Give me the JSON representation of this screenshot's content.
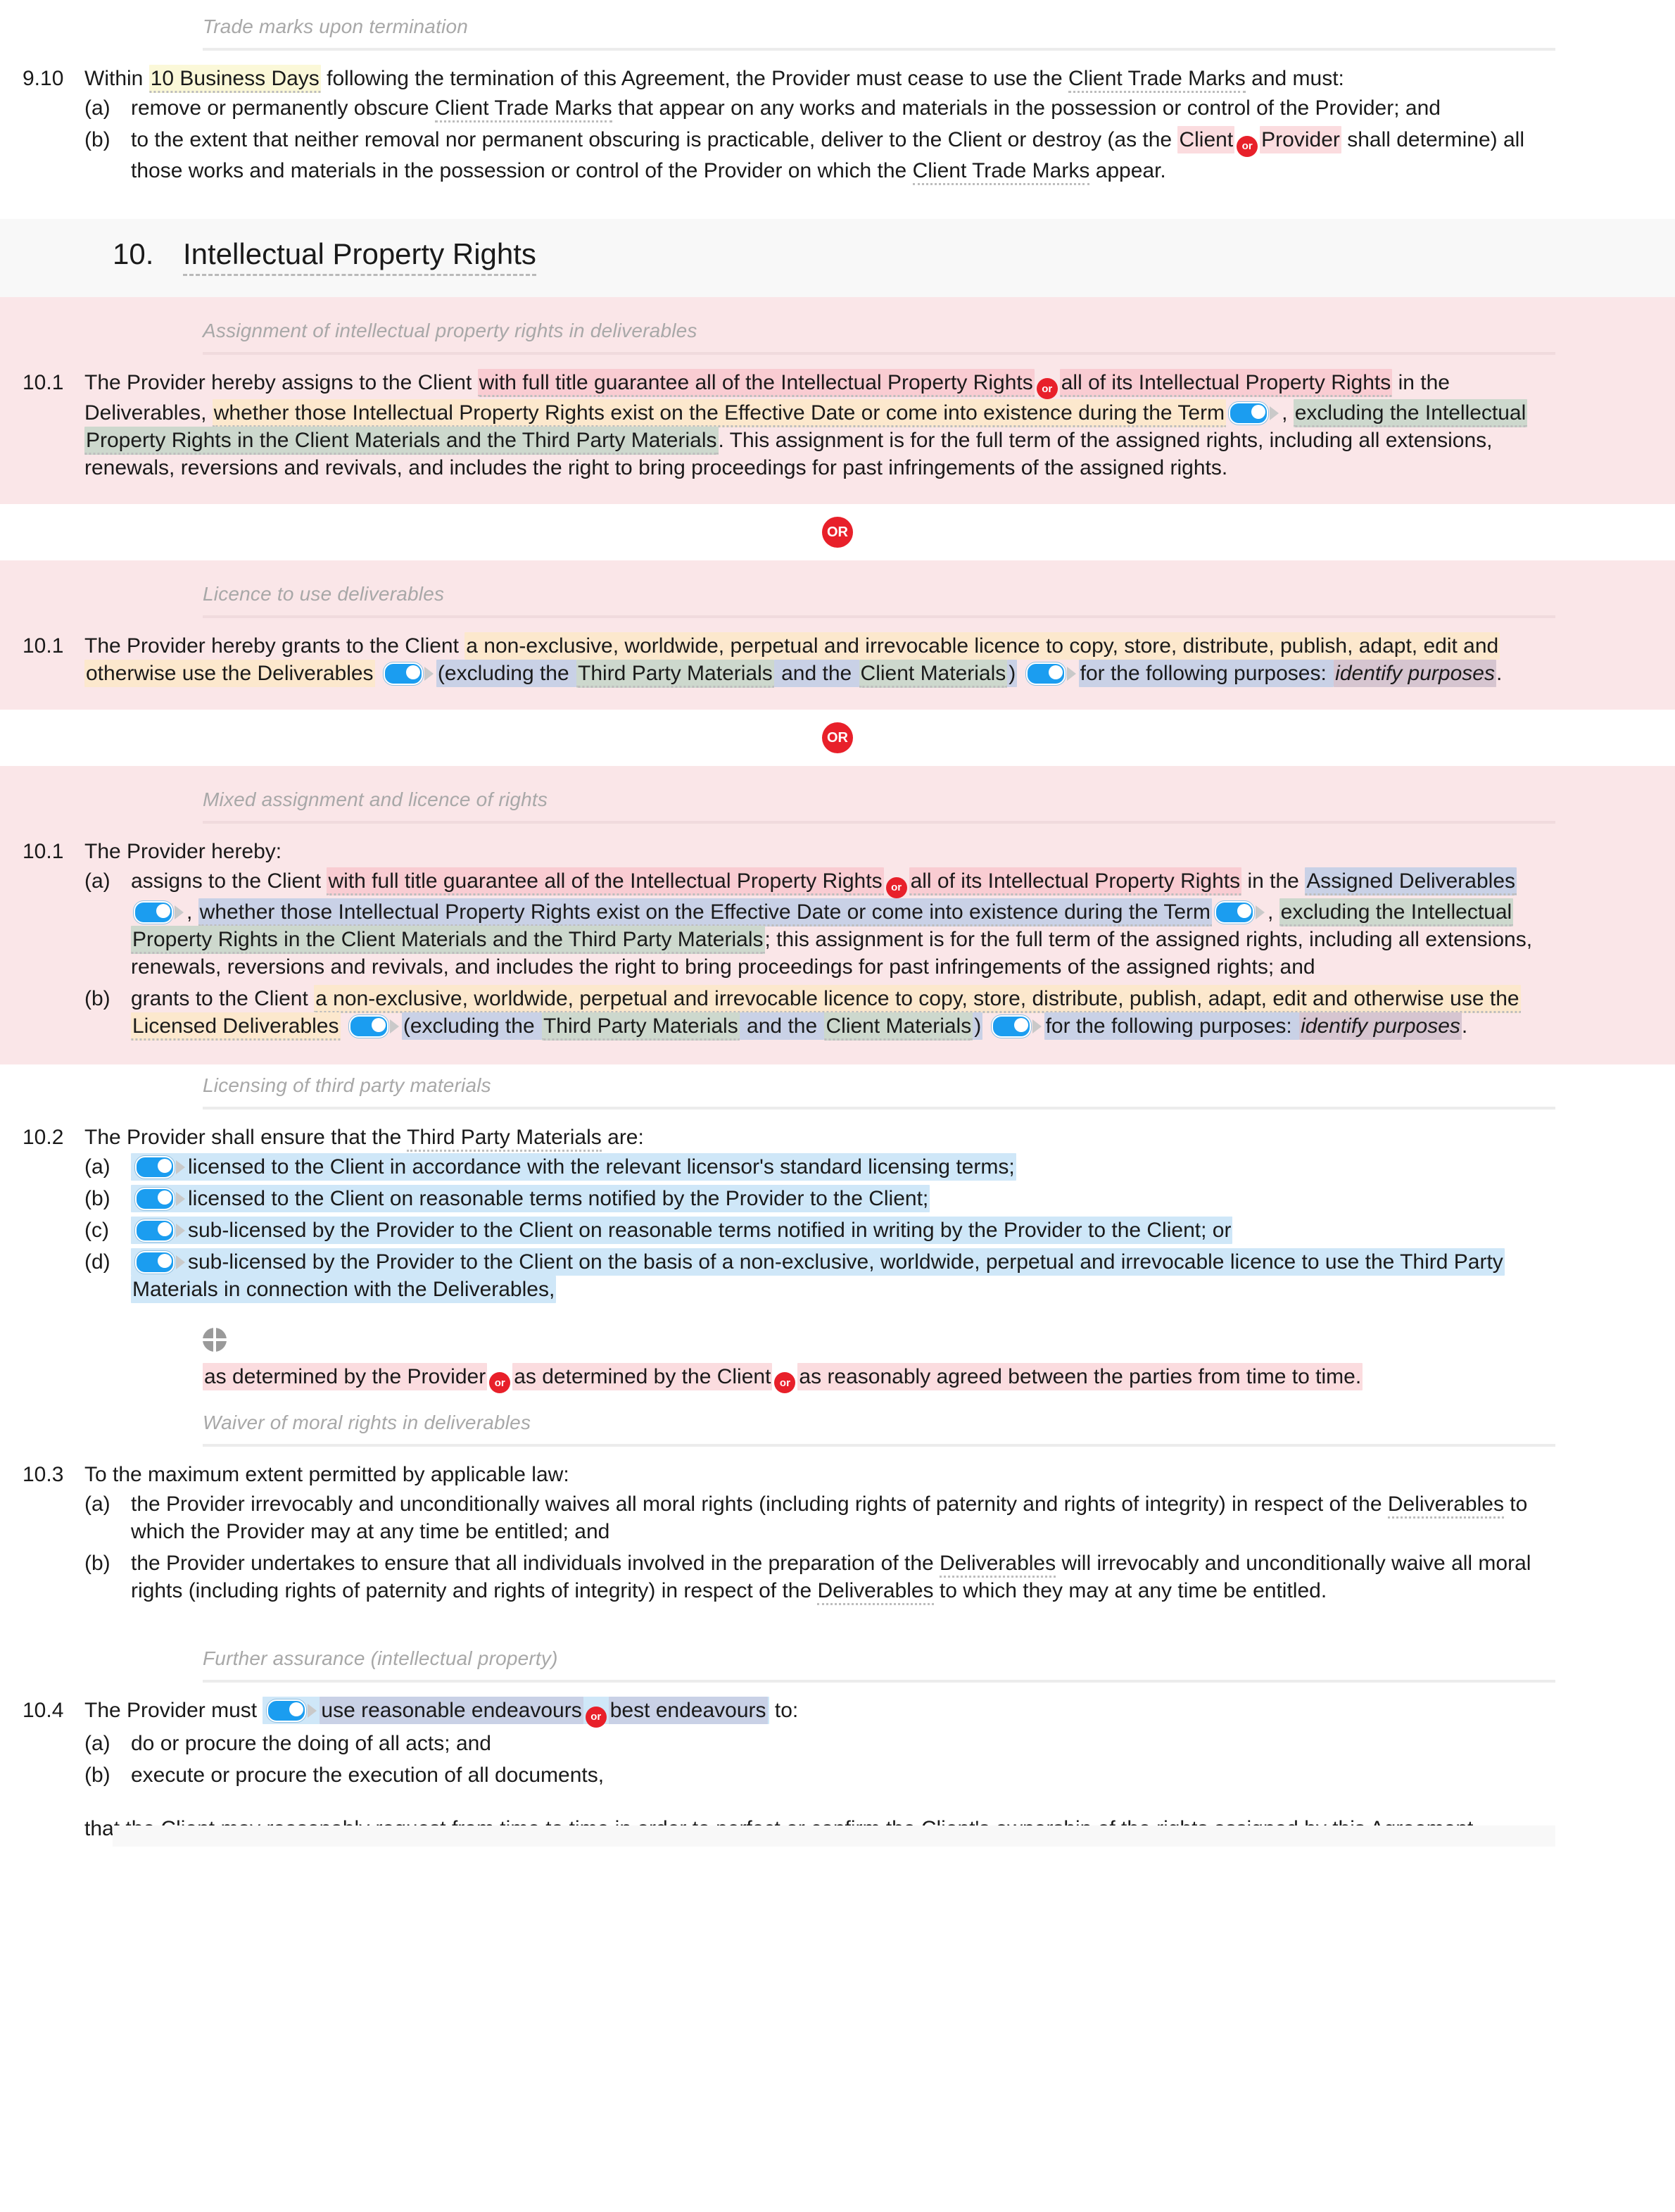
{
  "document": {
    "type": "contract-clause-editor",
    "colors": {
      "or_badge": "#e8202a",
      "toggle_on": "#1b9df0",
      "optional_block": "#fae6e8",
      "section_band": "#f8f8f8",
      "highlight_yellow": "#fbf8d8",
      "highlight_pink": "#f9ccd2",
      "highlight_orange": "#fce8cd",
      "highlight_green": "#cdd8cd",
      "highlight_lavender": "#c9d1e6",
      "highlight_blue": "#cfe7f8",
      "highlight_mauve": "#d6c5d0"
    }
  },
  "clause_9_10": {
    "subhead": "Trade marks upon termination",
    "number": "9.10",
    "lead_1": "Within ",
    "term_business_days": "10 Business Days",
    "lead_2": " following the termination of this Agreement, the Provider must cease to use the ",
    "term_client_trade_marks": "Client Trade Marks",
    "lead_3": " and must:",
    "items": [
      {
        "label": "(a)",
        "t1": "remove or permanently obscure ",
        "term": "Client Trade Marks",
        "t2": " that appear on any works and materials in the possession or control of the Provider; and"
      },
      {
        "label": "(b)",
        "t1": "to the extent that neither removal nor permanent obscuring is practicable, deliver to the Client or destroy (as the ",
        "opt_a": "Client",
        "or": "or",
        "opt_b": "Provider",
        "t2": " shall determine) all those works and materials in the possession or control of the Provider on which the ",
        "term": "Client Trade Marks",
        "t3": " appear."
      }
    ]
  },
  "section_10": {
    "number": "10.",
    "title": "Intellectual Property Rights"
  },
  "option_assignment": {
    "subhead": "Assignment of intellectual property rights in deliverables",
    "number": "10.1",
    "p1": "The Provider hereby assigns to the Client ",
    "opt_a": "with full title guarantee all of the Intellectual Property Rights",
    "or": "or",
    "opt_b": "all of its Intellectual Property Rights",
    "p2": " in the Deliverables, ",
    "orange": "whether those Intellectual Property Rights exist on the Effective Date or come into existence during the Term",
    "toggle": "toggle-switch",
    "p3": ", ",
    "green": "excluding the Intellectual Property Rights in the Client Materials and the Third Party Materials",
    "p4": ". This assignment is for the full term of the assigned rights, including all extensions, renewals, reversions and revivals, and includes the right to bring proceedings for past infringements of the assigned rights."
  },
  "or_divider_1": "OR",
  "option_licence": {
    "subhead": "Licence to use deliverables",
    "number": "10.1",
    "p1": "The Provider hereby grants to the Client ",
    "orange": "a non-exclusive, worldwide, perpetual and irrevocable licence to copy, store, distribute, publish, adapt, edit and otherwise use the Deliverables",
    "p2": " ",
    "lav_1": "(excluding the ",
    "green_1": "Third Party Materials",
    "lav_2": " and the ",
    "green_2": "Client Materials",
    "lav_3": ")",
    "p3": " ",
    "lav_4": "for the following purposes: ",
    "mauve": "identify purposes",
    "p4": "."
  },
  "or_divider_2": "OR",
  "option_mixed": {
    "subhead": "Mixed assignment and licence of rights",
    "number": "10.1",
    "lead": "The Provider hereby:",
    "item_a": {
      "label": "(a)",
      "p1": "assigns to the Client ",
      "opt_a": "with full title guarantee all of the Intellectual Property Rights",
      "or": "or",
      "opt_b": "all of its Intellectual Property Rights",
      "p2": " in the ",
      "lav_1": "Assigned Deliverables",
      "p3": ", ",
      "lav_2": "whether those Intellectual Property Rights exist on the Effective Date or come into existence during the Term",
      "p4": ", ",
      "green": "excluding the Intellectual Property Rights in the Client Materials and the Third Party Materials",
      "p5": "; this assignment is for the full term of the assigned rights, including all extensions, renewals, reversions and revivals, and includes the right to bring proceedings for past infringements of the assigned rights; and"
    },
    "item_b": {
      "label": "(b)",
      "p1": "grants to the Client ",
      "orange": "a non-exclusive, worldwide, perpetual and irrevocable licence to copy, store, distribute, publish, adapt, edit and otherwise use the Licensed Deliverables",
      "p2": " ",
      "lav_1": "(excluding the ",
      "green_1": "Third Party Materials",
      "lav_2": " and the ",
      "green_2": "Client Materials",
      "lav_3": ")",
      "p3": " ",
      "lav_4": "for the following purposes: ",
      "mauve": "identify purposes",
      "p4": "."
    }
  },
  "clause_10_2": {
    "subhead": "Licensing of third party materials",
    "number": "10.2",
    "lead_1": "The Provider shall ensure that the ",
    "term": "Third Party Materials",
    "lead_2": " are:",
    "items": [
      {
        "label": "(a)",
        "text": "licensed to the Client in accordance with the relevant licensor's standard licensing terms;"
      },
      {
        "label": "(b)",
        "text": "licensed to the Client on reasonable terms notified by the Provider to the Client;"
      },
      {
        "label": "(c)",
        "text": "sub-licensed by the Provider to the Client on reasonable terms notified in writing by the Provider to the Client; or"
      },
      {
        "label": "(d)",
        "text": "sub-licensed by the Provider to the Client on the basis of a non-exclusive, worldwide, perpetual and irrevocable licence to use the Third Party Materials in connection with the Deliverables,"
      }
    ],
    "handle_icon": "move-handle-icon",
    "tail_opt_a": "as determined by the Provider",
    "tail_or_1": "or",
    "tail_opt_b": "as determined by the Client",
    "tail_or_2": "or",
    "tail_opt_c": "as reasonably agreed between the parties from time to time."
  },
  "clause_10_3": {
    "subhead": "Waiver of moral rights in deliverables",
    "number": "10.3",
    "lead": "To the maximum extent permitted by applicable law:",
    "items": [
      {
        "label": "(a)",
        "t1": "the Provider irrevocably and unconditionally waives all moral rights (including rights of paternity and rights of integrity) in respect of the ",
        "term": "Deliverables",
        "t2": " to which the Provider may at any time be entitled; and"
      },
      {
        "label": "(b)",
        "t1": "the Provider undertakes to ensure that all individuals involved in the preparation of the ",
        "term": "Deliverables",
        "t2": " will irrevocably and unconditionally waive all moral rights (including rights of paternity and rights of integrity) in respect of the ",
        "term2": "Deliverables",
        "t3": " to which they may at any time be entitled."
      }
    ]
  },
  "clause_10_4": {
    "subhead": "Further assurance (intellectual property)",
    "number": "10.4",
    "p1": "The Provider must ",
    "opt_a": "use reasonable endeavours",
    "or": "or",
    "opt_b": "best endeavours",
    "p2": " to:",
    "items": [
      {
        "label": "(a)",
        "text": "do or procure the doing of all acts; and"
      },
      {
        "label": "(b)",
        "text": "execute or procure the execution of all documents,"
      }
    ],
    "tail": "that the Client may reasonably request from time to time in order to perfect or confirm the Client's ownership of the rights assigned by this Agreement."
  }
}
